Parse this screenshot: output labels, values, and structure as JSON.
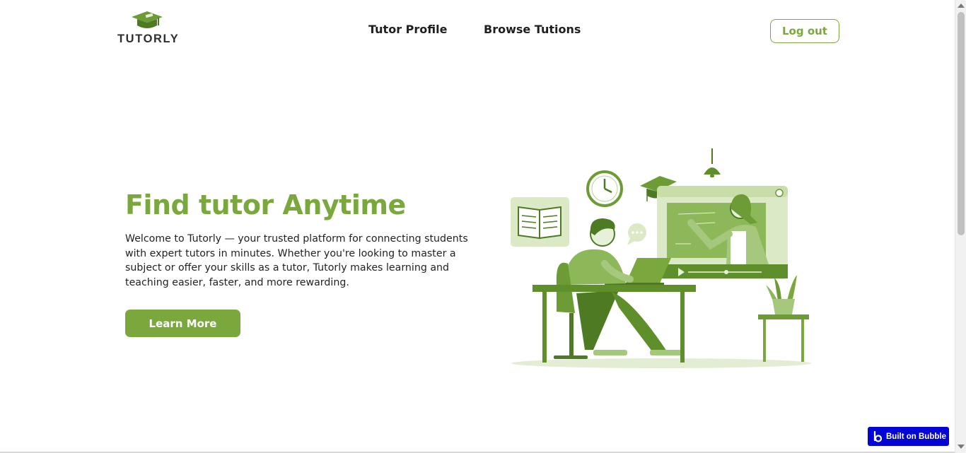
{
  "brand": {
    "name": "TUTORLY"
  },
  "nav": {
    "tutor_profile": "Tutor Profile",
    "browse_tutions": "Browse Tutions",
    "logout": "Log out"
  },
  "hero": {
    "title": "Find tutor Anytime",
    "description": "Welcome to Tutorly — your trusted platform for connecting students with expert tutors in minutes. Whether you're looking to master a subject or offer your skills as a tutor, Tutorly makes learning and teaching easier, faster, and more rewarding.",
    "cta": "Learn More"
  },
  "badge": {
    "label": "Built on Bubble"
  },
  "colors": {
    "accent": "#7aa83c",
    "badge": "#0205d3"
  },
  "icons": [
    "graduation-cap-icon",
    "bubble-logo-icon"
  ]
}
